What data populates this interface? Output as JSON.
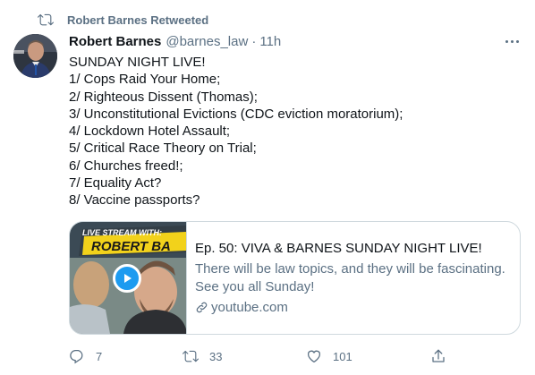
{
  "retweet_banner": {
    "label": "Robert Barnes Retweeted",
    "icon": "retweet-icon"
  },
  "tweet": {
    "author_name": "Robert Barnes",
    "handle": "@barnes_law",
    "separator": "·",
    "time": "11h",
    "lines": [
      "SUNDAY NIGHT LIVE!",
      "1/ Cops Raid Your Home;",
      "2/ Righteous Dissent (Thomas);",
      "3/ Unconstitutional Evictions (CDC eviction moratorium);",
      "4/ Lockdown Hotel Assault;",
      "5/ Critical Race Theory on Trial;",
      "6/ Churches freed!;",
      "7/ Equality Act?",
      "8/ Vaccine passports?"
    ]
  },
  "card": {
    "thumbnail_banner_line1": "LIVE STREAM WITH:",
    "thumbnail_banner_line2": "ROBERT BA",
    "title": "Ep. 50: VIVA & BARNES SUNDAY NIGHT LIVE!",
    "description_line1": "There will be law topics, and they will be fascinating.",
    "description_line2": "See you all Sunday!",
    "link": "youtube.com"
  },
  "actions": {
    "reply": {
      "icon": "reply-icon",
      "count": "7"
    },
    "retweet": {
      "icon": "retweet-icon",
      "count": "33"
    },
    "like": {
      "icon": "heart-icon",
      "count": "101"
    },
    "share": {
      "icon": "share-icon"
    }
  },
  "colors": {
    "text_primary": "#0f1419",
    "text_secondary": "#5b7083",
    "border": "#cfd9de",
    "play_button": "#1d9bf0",
    "thumb_banner": "#f2d21b"
  }
}
